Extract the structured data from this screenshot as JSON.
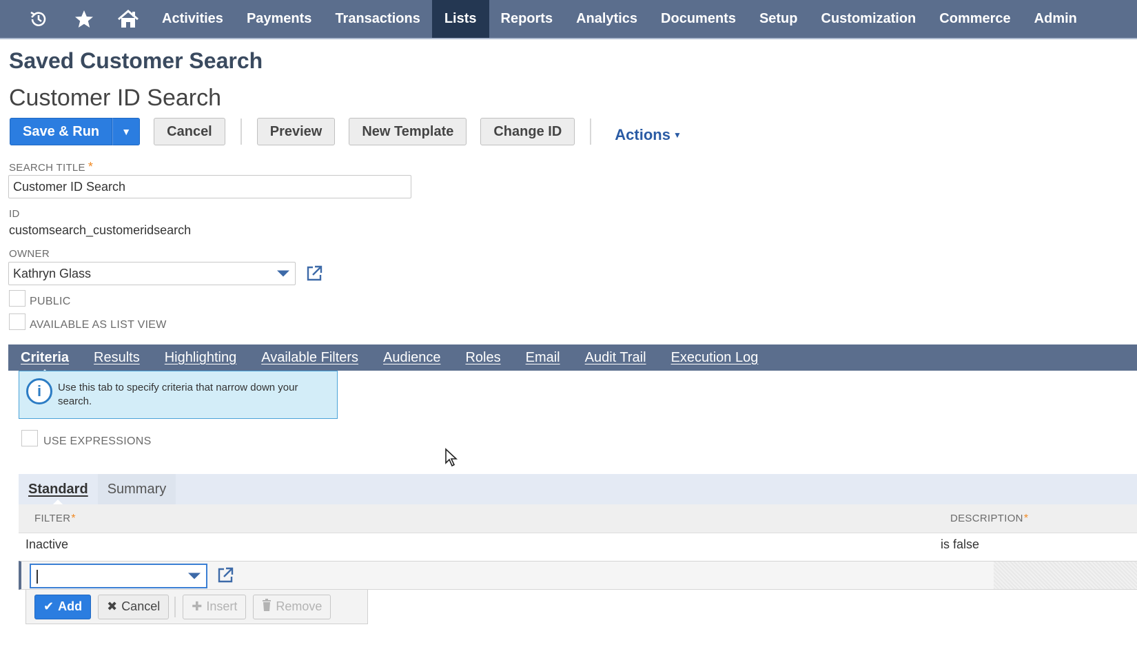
{
  "nav": {
    "icons": [
      "recent-icon",
      "star-icon",
      "home-icon"
    ],
    "items": [
      "Activities",
      "Payments",
      "Transactions",
      "Lists",
      "Reports",
      "Analytics",
      "Documents",
      "Setup",
      "Customization",
      "Commerce",
      "Admin"
    ],
    "active": "Lists"
  },
  "page": {
    "title": "Saved Customer Search",
    "record_name": "Customer ID Search"
  },
  "toolbar": {
    "save_run": "Save & Run",
    "cancel": "Cancel",
    "preview": "Preview",
    "new_template": "New Template",
    "change_id": "Change ID",
    "actions": "Actions"
  },
  "form": {
    "search_title_label": "SEARCH TITLE",
    "search_title_value": "Customer ID Search",
    "id_label": "ID",
    "id_value": "customsearch_customeridsearch",
    "owner_label": "OWNER",
    "owner_value": "Kathryn Glass",
    "public_label": "PUBLIC",
    "public_checked": false,
    "list_view_label": "AVAILABLE AS LIST VIEW",
    "list_view_checked": false
  },
  "subtabs": {
    "items": [
      "Criteria",
      "Results",
      "Highlighting",
      "Available Filters",
      "Audience",
      "Roles",
      "Email",
      "Audit Trail",
      "Execution Log"
    ],
    "active": "Criteria"
  },
  "criteria": {
    "info_text": "Use this tab to specify criteria that narrow down your search.",
    "use_expressions_label": "USE EXPRESSIONS",
    "use_expressions_checked": false,
    "inner_tabs": [
      "Standard",
      "Summary"
    ],
    "inner_active": "Standard",
    "columns": {
      "filter": "FILTER",
      "description": "DESCRIPTION"
    },
    "rows": [
      {
        "filter": "Inactive",
        "description": "is false"
      }
    ],
    "edit_row_value": "",
    "row_buttons": {
      "add": "Add",
      "cancel": "Cancel",
      "insert": "Insert",
      "remove": "Remove"
    }
  },
  "colors": {
    "nav_bg": "#5b6e8d",
    "nav_active": "#243752",
    "primary_button": "#2b7de0",
    "required_star": "#f08a24",
    "info_bg": "#d3edf8"
  }
}
